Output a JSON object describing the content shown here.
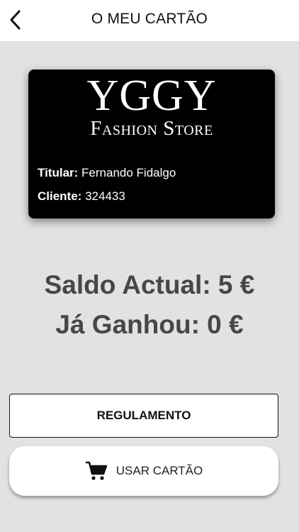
{
  "header": {
    "title": "O MEU CARTÃO",
    "back_icon": "chevron-left-icon"
  },
  "card": {
    "brand_line1": "YGGY",
    "brand_line2": "Fashion Store",
    "holder_label": "Titular:",
    "holder_value": "Fernando Fidalgo",
    "client_label": "Cliente:",
    "client_value": "324433"
  },
  "balance": {
    "current": "Saldo Actual: 5 €",
    "earned": "Já Ganhou: 0 €"
  },
  "buttons": {
    "regulamento": "REGULAMENTO",
    "usar_cartao": "USAR CARTÃO",
    "cart_icon": "shopping-cart-icon"
  },
  "colors": {
    "background": "#e2e2e2",
    "card": "#000000",
    "balance_text": "#474747"
  }
}
